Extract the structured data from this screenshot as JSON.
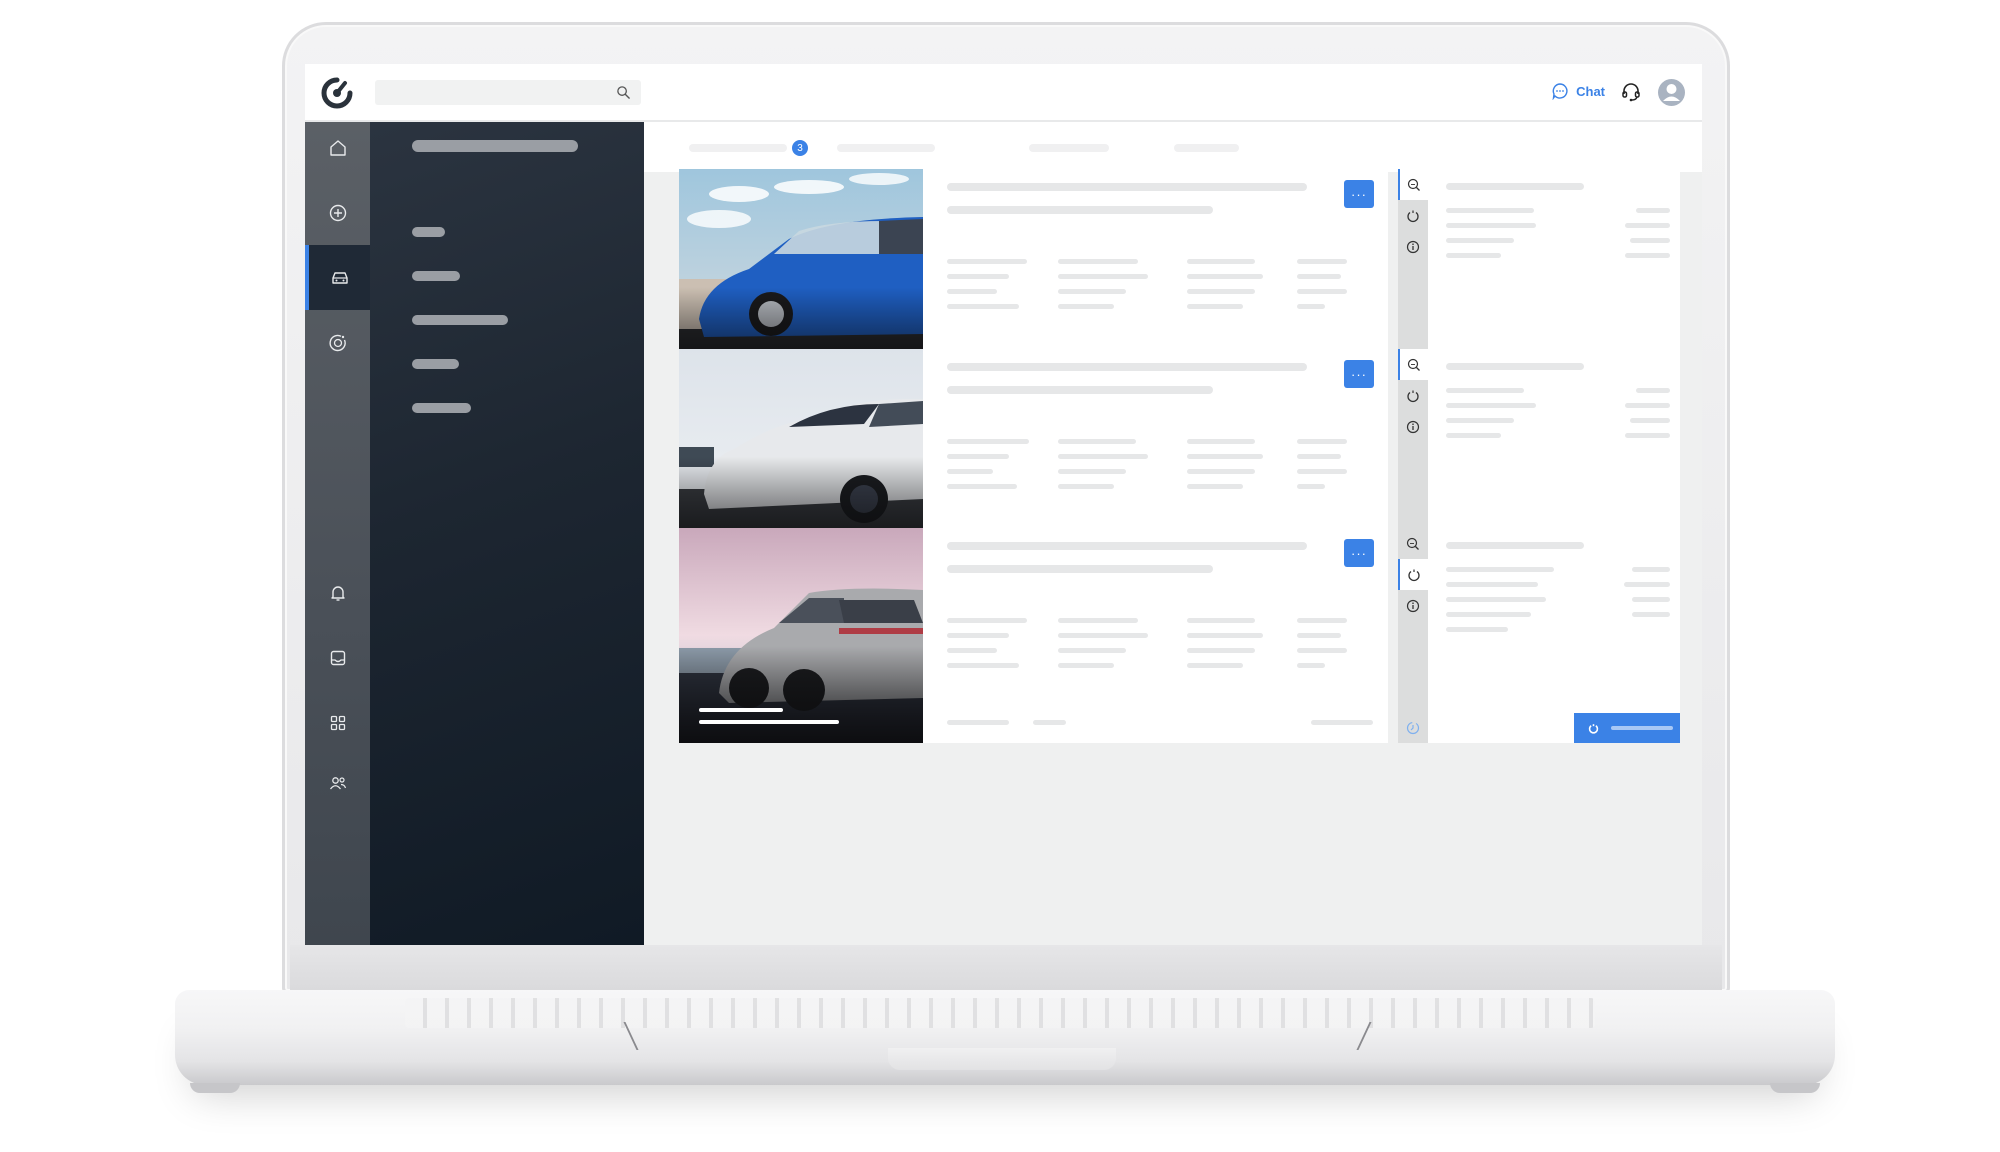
{
  "header": {
    "logo": "gauge-logo-icon",
    "search": {
      "placeholder": "",
      "value": "",
      "icon": "search-icon"
    },
    "chat_label": "Chat",
    "chat_icon": "chat-bubble-icon",
    "support_icon": "headset-icon",
    "avatar_icon": "user-avatar-icon"
  },
  "nav_rail": {
    "items": [
      {
        "name": "home",
        "icon": "home-icon",
        "active": false
      },
      {
        "name": "add",
        "icon": "plus-circle-icon",
        "active": false
      },
      {
        "name": "vehicles",
        "icon": "car-icon",
        "active": true
      },
      {
        "name": "wheel",
        "icon": "wheel-refresh-icon",
        "active": false
      },
      {
        "name": "notifications",
        "icon": "bell-icon",
        "active": false
      },
      {
        "name": "inbox",
        "icon": "inbox-icon",
        "active": false
      },
      {
        "name": "apps",
        "icon": "grid-icon",
        "active": false
      },
      {
        "name": "users",
        "icon": "users-icon",
        "active": false
      }
    ]
  },
  "tabs": {
    "badge_count": "3",
    "count": 4
  },
  "colors": {
    "accent": "#3b82e6",
    "panel_dark": "#1d2631",
    "rail": "#4a5058",
    "content_bg": "#eff0f0",
    "placeholder": "#e6e7e8"
  },
  "cards": [
    {
      "image": "blue hatchback on roadside under cloudy sky",
      "more_label": "···",
      "active_side_tab": 0,
      "progress": 1.0,
      "show_progress": true
    },
    {
      "image": "white electric SUV driving on road",
      "more_label": "···",
      "active_side_tab": 0,
      "progress": 1.0,
      "show_progress": true
    },
    {
      "image": "silver crossover SUV at dusk, rear view",
      "more_label": "···",
      "active_side_tab": 1,
      "progress": 0,
      "show_progress": false
    }
  ],
  "side_tabs": [
    "zoom-search-icon",
    "timer-icon",
    "info-icon"
  ],
  "side_footer_icon": "clock-icon",
  "action_icon": "timer-icon"
}
